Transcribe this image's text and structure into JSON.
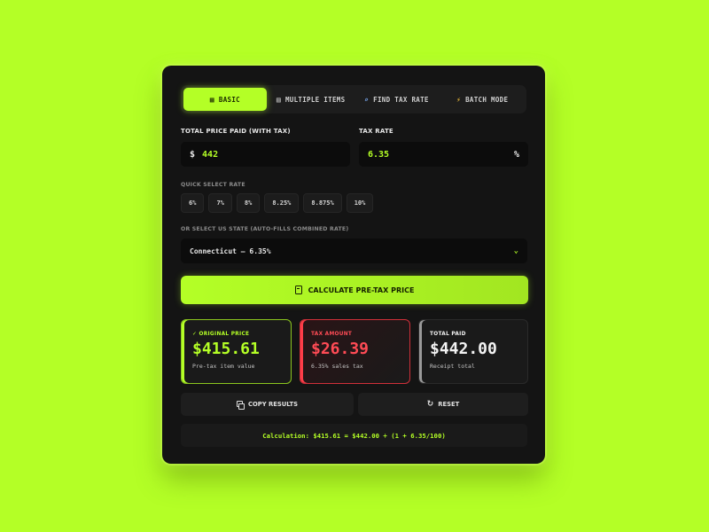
{
  "tabs": [
    {
      "label": "BASIC",
      "icon": "calculator-icon",
      "active": true
    },
    {
      "label": "MULTIPLE ITEMS",
      "icon": "list-icon",
      "active": false
    },
    {
      "label": "FIND TAX RATE",
      "icon": "search-icon",
      "active": false
    },
    {
      "label": "BATCH MODE",
      "icon": "lightning-icon",
      "active": false
    }
  ],
  "price_field": {
    "label": "TOTAL PRICE PAID (WITH TAX)",
    "currency": "$",
    "value": "442"
  },
  "rate_field": {
    "label": "TAX RATE",
    "value": "6.35",
    "unit": "%"
  },
  "quick_select": {
    "label": "QUICK SELECT RATE",
    "rates": [
      "6%",
      "7%",
      "8%",
      "8.25%",
      "8.875%",
      "10%"
    ]
  },
  "state_select": {
    "label": "OR SELECT US STATE (AUTO-FILLS COMBINED RATE)",
    "value": "Connecticut — 6.35%"
  },
  "calculate_button": {
    "label": "CALCULATE PRE-TAX PRICE"
  },
  "results": {
    "original": {
      "title": "✓ ORIGINAL PRICE",
      "value": "$415.61",
      "sub": "Pre-tax item value"
    },
    "tax": {
      "title": "TAX AMOUNT",
      "value": "$26.39",
      "sub": "6.35% sales tax"
    },
    "total": {
      "title": "TOTAL PAID",
      "value": "$442.00",
      "sub": "Receipt total"
    }
  },
  "actions": {
    "copy": "COPY RESULTS",
    "reset": "RESET"
  },
  "formula": "Calculation: $415.61 = $442.00 ÷ (1 + 6.35/100)",
  "colors": {
    "accent": "#b4ff26",
    "danger": "#ff4b55",
    "panel": "#141414",
    "background": "#b4ff26"
  }
}
